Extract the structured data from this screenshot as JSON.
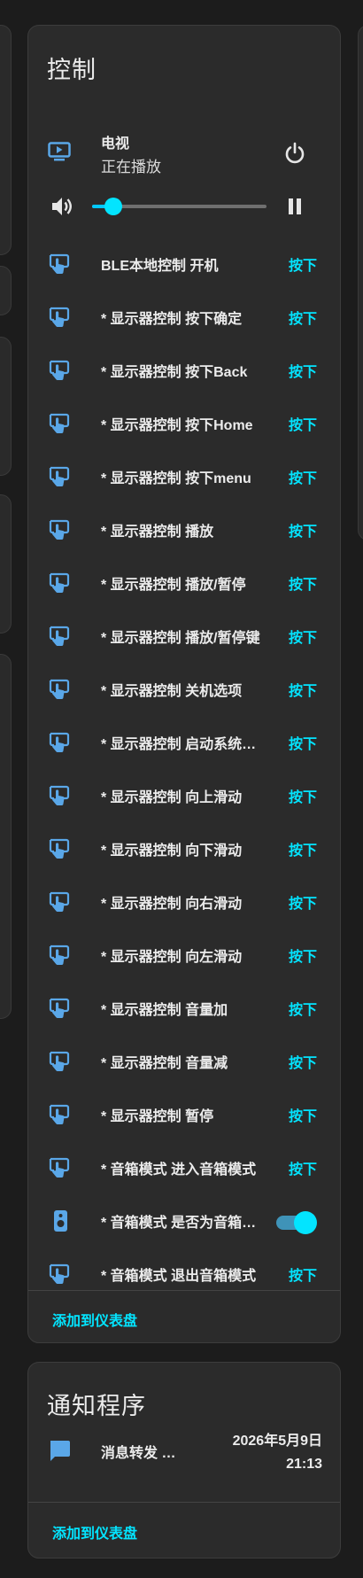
{
  "control_card": {
    "title": "控制",
    "media": {
      "name": "电视",
      "state": "正在播放",
      "volume_percent": 12
    },
    "rows": [
      {
        "label": "BLE本地控制 开机",
        "action": "按下",
        "icon": "remote-press-icon"
      },
      {
        "label": "* 显示器控制 按下确定",
        "action": "按下",
        "icon": "remote-press-icon"
      },
      {
        "label": "* 显示器控制 按下Back",
        "action": "按下",
        "icon": "remote-press-icon"
      },
      {
        "label": "* 显示器控制 按下Home",
        "action": "按下",
        "icon": "remote-press-icon"
      },
      {
        "label": "* 显示器控制 按下menu",
        "action": "按下",
        "icon": "remote-press-icon"
      },
      {
        "label": "* 显示器控制 播放",
        "action": "按下",
        "icon": "remote-press-icon"
      },
      {
        "label": "* 显示器控制 播放/暂停",
        "action": "按下",
        "icon": "remote-press-icon"
      },
      {
        "label": "* 显示器控制 播放/暂停键",
        "action": "按下",
        "icon": "remote-press-icon"
      },
      {
        "label": "* 显示器控制 关机选项",
        "action": "按下",
        "icon": "remote-press-icon"
      },
      {
        "label": "* 显示器控制 启动系统设置",
        "action": "按下",
        "icon": "remote-press-icon"
      },
      {
        "label": "* 显示器控制 向上滑动",
        "action": "按下",
        "icon": "remote-press-icon"
      },
      {
        "label": "* 显示器控制 向下滑动",
        "action": "按下",
        "icon": "remote-press-icon"
      },
      {
        "label": "* 显示器控制 向右滑动",
        "action": "按下",
        "icon": "remote-press-icon"
      },
      {
        "label": "* 显示器控制 向左滑动",
        "action": "按下",
        "icon": "remote-press-icon"
      },
      {
        "label": "* 显示器控制 音量加",
        "action": "按下",
        "icon": "remote-press-icon"
      },
      {
        "label": "* 显示器控制 音量减",
        "action": "按下",
        "icon": "remote-press-icon"
      },
      {
        "label": "* 显示器控制 暂停",
        "action": "按下",
        "icon": "remote-press-icon"
      },
      {
        "label": "* 音箱模式 进入音箱模式",
        "action": "按下",
        "icon": "remote-press-icon"
      },
      {
        "label": "* 音箱模式 是否为音箱模式",
        "action": "toggle",
        "toggle_on": true,
        "icon": "speaker-icon"
      },
      {
        "label": "* 音箱模式 退出音箱模式",
        "action": "按下",
        "icon": "remote-press-icon"
      }
    ],
    "footer_button": "添加到仪表盘"
  },
  "notify_card": {
    "title": "通知程序",
    "item_name": "消息转发 …",
    "date": "2026年5月9日",
    "time": "21:13",
    "footer_button": "添加到仪表盘"
  },
  "colors": {
    "accent": "#03e4ff",
    "icon_blue": "#5aa7e8",
    "card_bg": "#2b2b2b",
    "page_bg": "#1c1c1c"
  }
}
